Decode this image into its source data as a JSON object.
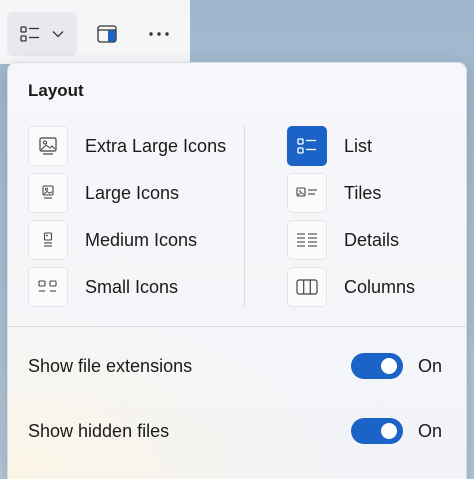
{
  "toolbar": {
    "layout_button_icon": "list-view-icon",
    "chevron_icon": "chevron-down-icon",
    "pane_button_icon": "details-pane-icon",
    "more_button_icon": "more-options-icon"
  },
  "flyout": {
    "title": "Layout",
    "left_options": [
      {
        "label": "Extra Large Icons",
        "icon": "extra-large-icons-icon"
      },
      {
        "label": "Large Icons",
        "icon": "large-icons-icon"
      },
      {
        "label": "Medium Icons",
        "icon": "medium-icons-icon"
      },
      {
        "label": "Small Icons",
        "icon": "small-icons-icon"
      }
    ],
    "right_options": [
      {
        "label": "List",
        "icon": "list-icon",
        "selected": true
      },
      {
        "label": "Tiles",
        "icon": "tiles-icon"
      },
      {
        "label": "Details",
        "icon": "details-icon"
      },
      {
        "label": "Columns",
        "icon": "columns-icon"
      }
    ],
    "toggles": [
      {
        "label": "Show file extensions",
        "state": "On",
        "on": true
      },
      {
        "label": "Show hidden files",
        "state": "On",
        "on": true
      }
    ]
  },
  "colors": {
    "accent": "#1b63c6",
    "desktop_background": "#a8bed3"
  }
}
